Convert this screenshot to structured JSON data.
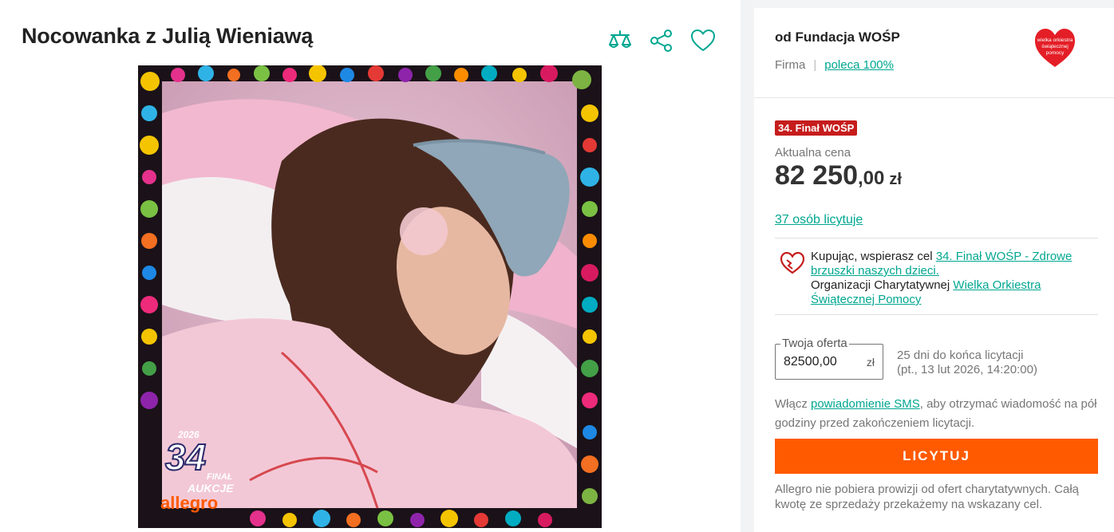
{
  "listing": {
    "title": "Nocowanka z Julią Wieniawą",
    "image_alt": "Photo of Julia Wieniawa in pink pajamas with a blue sleep mask, framed with colorful WOŚP border",
    "frame_badge_year": "2026",
    "frame_badge_number": "34",
    "frame_badge_final": "FINAŁ",
    "frame_badge_auctions": "AUKCJE",
    "frame_badge_brand": "allegro"
  },
  "actions": {
    "compare_icon": "scales-icon",
    "share_icon": "share-icon",
    "favorite_icon": "heart-icon"
  },
  "seller": {
    "name": "od Fundacja WOŚP",
    "type": "Firma",
    "recommend": "poleca 100%",
    "logo_text": "wielka orkiestra świątecznej pomocy"
  },
  "offer": {
    "badge": "34. Finał WOŚP",
    "price_label": "Aktualna cena",
    "price_int": "82 250",
    "price_dec": ",00",
    "currency": "zł",
    "bidders": "37 osób licytuje",
    "charity_text_1": "Kupując, wspierasz cel ",
    "charity_link_1": "34. Finał WOŚP - Zdrowe brzuszki naszych dzieci.",
    "charity_text_2": "Organizacji Charytatywnej ",
    "charity_link_2": "Wielka Orkiestra Świątecznej Pomocy",
    "your_offer_label": "Twoja oferta",
    "your_offer_value": "82500,00",
    "your_offer_currency": "zł",
    "deadline_line1": "25 dni do końca licytacji",
    "deadline_line2": "(pt., 13 lut 2026, 14:20:00)",
    "sms_text_1": "Włącz ",
    "sms_link": "powiadomienie SMS",
    "sms_text_2": ", aby otrzymać wiadomość na pół godziny przed zakończeniem licytacji.",
    "bid_button": "LICYTUJ",
    "note": "Allegro nie pobiera prowizji od ofert charytatywnych. Całą kwotę ze sprzedaży przekażemy na wskazany cel."
  },
  "colors": {
    "accent_teal": "#00a790",
    "bid_orange": "#ff5a00",
    "badge_red": "#c61c1c",
    "wosp_heart": "#e41e26"
  }
}
